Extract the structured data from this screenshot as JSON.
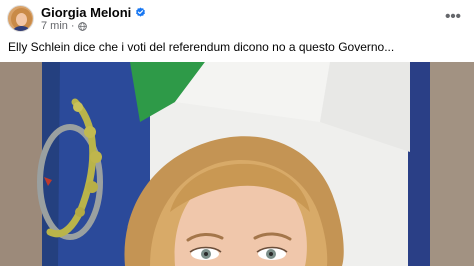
{
  "post": {
    "author": "Giorgia Meloni",
    "timestamp": "7 min",
    "separator": "·",
    "text": "Elly Schlein dice che i voti del referendum dicono no a questo Governo...",
    "more_options": "•••"
  },
  "icons": {
    "verified": "verified-badge-icon",
    "audience": "globe-icon",
    "more": "more-options-icon"
  },
  "colors": {
    "verified_blue": "#1877f2",
    "secondary_text": "#65676b"
  }
}
